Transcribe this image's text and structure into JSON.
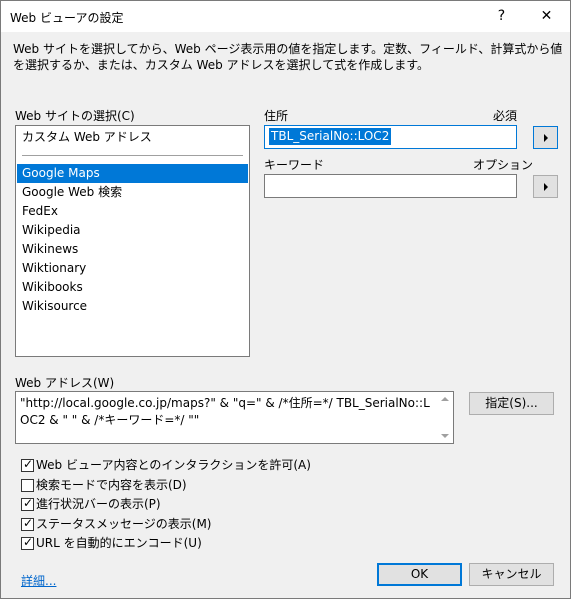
{
  "window": {
    "title": "Web ビューアの設定",
    "help_glyph": "?",
    "close_glyph": "✕"
  },
  "description": "Web サイトを選択してから、Web ページ表示用の値を指定します。定数、フィールド、計算式から値を選択するか、または、カスタム Web アドレスを選択して式を作成します。",
  "site_list": {
    "label": "Web サイトの選択(C)",
    "custom": "カスタム Web アドレス",
    "items": [
      "Google Maps",
      "Google Web 検索",
      "FedEx",
      "Wikipedia",
      "Wikinews",
      "Wiktionary",
      "Wikibooks",
      "Wikisource"
    ],
    "selected": "Google Maps"
  },
  "address": {
    "label": "住所",
    "required": "必須",
    "value": "TBL_SerialNo::LOC2"
  },
  "keyword": {
    "label": "キーワード",
    "optional": "オプション",
    "value": ""
  },
  "web_address": {
    "label": "Web アドレス(W)",
    "value": "\"http://local.google.co.jp/maps?\" & \"q=\" & /*住所=*/ TBL_SerialNo::LOC2 & \" \" & /*キーワード=*/ \"\"",
    "specify_button": "指定(S)..."
  },
  "options": [
    {
      "label": "Web ビューア内容とのインタラクションを許可(A)",
      "checked": true
    },
    {
      "label": "検索モードで内容を表示(D)",
      "checked": false
    },
    {
      "label": "進行状況バーの表示(P)",
      "checked": true
    },
    {
      "label": "ステータスメッセージの表示(M)",
      "checked": true
    },
    {
      "label": "URL を自動的にエンコード(U)",
      "checked": true
    }
  ],
  "footer": {
    "details_link": "詳細...",
    "ok": "OK",
    "cancel": "キャンセル"
  },
  "colors": {
    "accent": "#0078d7",
    "link": "#0066cc",
    "dialog_bg": "#f0f0f0"
  }
}
